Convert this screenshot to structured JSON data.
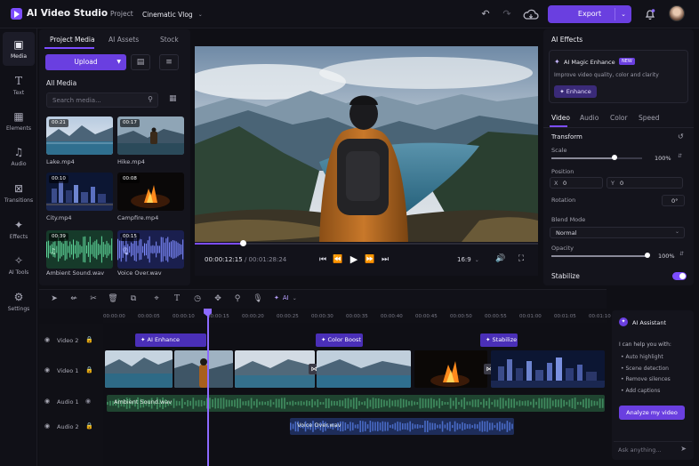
{
  "header": {
    "app_title": "AI Video Studio",
    "project_label": "Project",
    "project_name": "Cinematic Vlog",
    "export_label": "Export"
  },
  "rail": [
    {
      "icon": "media-icon",
      "label": "Media"
    },
    {
      "icon": "text-icon",
      "label": "Text"
    },
    {
      "icon": "elements-icon",
      "label": "Elements"
    },
    {
      "icon": "audio-icon",
      "label": "Audio"
    },
    {
      "icon": "transitions-icon",
      "label": "Transitions"
    },
    {
      "icon": "effects-icon",
      "label": "Effects"
    },
    {
      "icon": "ai-tools-icon",
      "label": "AI Tools"
    },
    {
      "icon": "settings-icon",
      "label": "Settings"
    }
  ],
  "media_panel": {
    "tabs": [
      "Project Media",
      "AI Assets",
      "Stock"
    ],
    "upload_label": "Upload",
    "section_title": "All Media",
    "search_placeholder": "Search media...",
    "items": [
      {
        "name": "Lake.mp4",
        "duration": "00:21"
      },
      {
        "name": "Hike.mp4",
        "duration": "00:17"
      },
      {
        "name": "City.mp4",
        "duration": "00:10"
      },
      {
        "name": "Campfire.mp4",
        "duration": "00:08"
      },
      {
        "name": "Ambient Sound.wav",
        "duration": "00:39"
      },
      {
        "name": "Voice Over.wav",
        "duration": "00:15"
      }
    ]
  },
  "player": {
    "current_time": "00:00:12:15",
    "separator": "/",
    "total_time": "00:01:28:24",
    "aspect": "16:9",
    "progress": 0.14
  },
  "effects_panel": {
    "title": "AI Effects",
    "magic_title": "AI Magic Enhance",
    "badge": "NEW",
    "magic_desc": "Improve video quality, color and clarity",
    "enhance_label": "Enhance",
    "tabs": [
      "Video",
      "Audio",
      "Color",
      "Speed"
    ],
    "section": "Transform",
    "scale_label": "Scale",
    "scale_value": "100%",
    "scale_level": 0.5,
    "position_label": "Position",
    "x_label": "X",
    "x_value": "0",
    "y_label": "Y",
    "y_value": "0",
    "rotation_label": "Rotation",
    "rotation_value": "0°",
    "blend_label": "Blend Mode",
    "blend_value": "Normal",
    "opacity_label": "Opacity",
    "opacity_value": "100%",
    "opacity_level": 1.0,
    "stabilize_label": "Stabilize"
  },
  "timeline": {
    "ticks": [
      "00:00:00",
      "00:00:05",
      "00:00:10",
      "00:00:15",
      "00:00:20",
      "00:00:25",
      "00:00:30",
      "00:00:35",
      "00:00:40",
      "00:00:45",
      "00:00:50",
      "00:00:55",
      "00:01:00",
      "00:01:05",
      "00:01:10"
    ],
    "tracks": [
      "Video 2",
      "Video 1",
      "Audio 1",
      "Audio 2"
    ],
    "effects": [
      "AI Enhance",
      "Color Boost",
      "Stabilize"
    ],
    "audio1_label": "Ambient Sound.wav",
    "audio2_label": "Voice Over.wav",
    "ai_label": "AI"
  },
  "assistant": {
    "title": "AI Assistant",
    "intro": "I can help you with:",
    "items": [
      "Auto highlight",
      "Scene detection",
      "Remove silences",
      "Add captions"
    ],
    "analyze_label": "Analyze my video",
    "ask_placeholder": "Ask anything..."
  }
}
